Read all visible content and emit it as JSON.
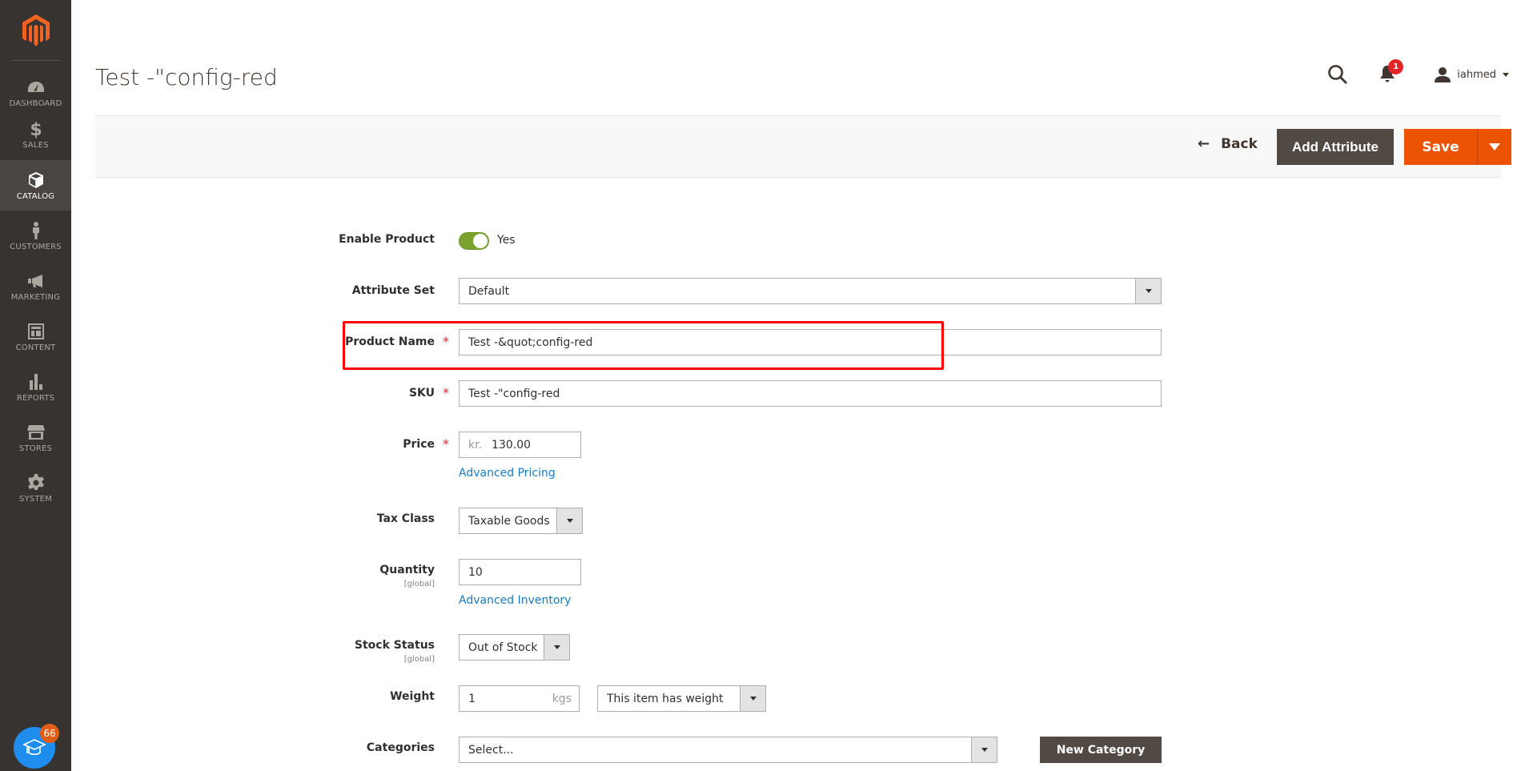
{
  "sidebar": {
    "logo": "magento-logo",
    "items": [
      {
        "label": "DASHBOARD",
        "icon": "dashboard-icon"
      },
      {
        "label": "SALES",
        "icon": "dollar-icon"
      },
      {
        "label": "CATALOG",
        "icon": "box-icon",
        "active": true
      },
      {
        "label": "CUSTOMERS",
        "icon": "person-icon"
      },
      {
        "label": "MARKETING",
        "icon": "megaphone-icon"
      },
      {
        "label": "CONTENT",
        "icon": "layout-icon"
      },
      {
        "label": "REPORTS",
        "icon": "bar-chart-icon"
      },
      {
        "label": "STORES",
        "icon": "storefront-icon"
      },
      {
        "label": "SYSTEM",
        "icon": "gear-icon"
      }
    ],
    "help_badge": "66"
  },
  "header": {
    "title": "Test -\"config-red",
    "notification_count": "1",
    "username": "iahmed"
  },
  "actions": {
    "back": "Back",
    "add_attribute": "Add Attribute",
    "save": "Save"
  },
  "form": {
    "enable_product": {
      "label": "Enable Product",
      "value": "Yes",
      "enabled": true
    },
    "attribute_set": {
      "label": "Attribute Set",
      "value": "Default"
    },
    "product_name": {
      "label": "Product Name",
      "value": "Test -&quot;config-red",
      "required": "*"
    },
    "sku": {
      "label": "SKU",
      "value": "Test -\"config-red",
      "required": "*"
    },
    "price": {
      "label": "Price",
      "currency": "kr.",
      "value": "130.00",
      "required": "*",
      "link": "Advanced Pricing"
    },
    "tax_class": {
      "label": "Tax Class",
      "value": "Taxable Goods"
    },
    "quantity": {
      "label": "Quantity",
      "scope": "[global]",
      "value": "10",
      "link": "Advanced Inventory"
    },
    "stock_status": {
      "label": "Stock Status",
      "scope": "[global]",
      "value": "Out of Stock"
    },
    "weight": {
      "label": "Weight",
      "value": "1",
      "unit": "kgs",
      "type": "This item has weight"
    },
    "categories": {
      "label": "Categories",
      "placeholder": "Select...",
      "new_button": "New Category"
    }
  },
  "colors": {
    "accent": "#eb5202",
    "sidebar": "#373330",
    "highlight": "#ff0000",
    "toggle_on": "#79a22e",
    "link": "#1979c3"
  }
}
